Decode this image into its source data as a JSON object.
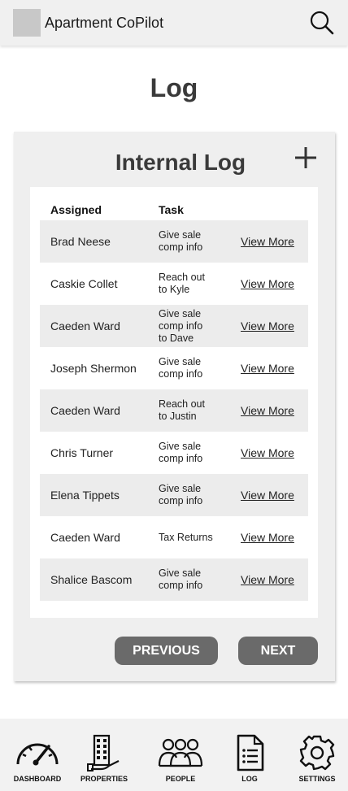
{
  "app": {
    "title": "Apartment CoPilot"
  },
  "header": {
    "search_icon": "search-icon",
    "logo_icon": "logo-placeholder"
  },
  "page": {
    "title": "Log"
  },
  "card": {
    "title": "Internal Log",
    "add_icon": "plus-icon"
  },
  "table": {
    "columns": [
      "Assigned",
      "Task"
    ],
    "link_label": "View More",
    "rows": [
      {
        "assigned": "Brad Neese",
        "task": "Give sale\ncomp info"
      },
      {
        "assigned": "Caskie Collet",
        "task": "Reach out\nto Kyle"
      },
      {
        "assigned": "Caeden Ward",
        "task": "Give sale\ncomp info\nto Dave"
      },
      {
        "assigned": "Joseph Shermon",
        "task": "Give sale\ncomp info"
      },
      {
        "assigned": "Caeden Ward",
        "task": "Reach out\nto Justin"
      },
      {
        "assigned": "Chris Turner",
        "task": "Give sale\ncomp info"
      },
      {
        "assigned": "Elena Tippets",
        "task": "Give sale\ncomp info"
      },
      {
        "assigned": "Caeden Ward",
        "task": "Tax Returns"
      },
      {
        "assigned": "Shalice Bascom",
        "task": "Give sale\ncomp info"
      }
    ]
  },
  "pagination": {
    "previous_label": "PREVIOUS",
    "next_label": "NEXT"
  },
  "nav": {
    "items": [
      {
        "label": "DASHBOARD",
        "icon": "gauge-icon"
      },
      {
        "label": "PROPERTIES",
        "icon": "building-icon"
      },
      {
        "label": "PEOPLE",
        "icon": "people-icon"
      },
      {
        "label": "LOG",
        "icon": "document-icon"
      },
      {
        "label": "SETTINGS",
        "icon": "gear-icon"
      }
    ]
  },
  "colors": {
    "button": "#6a6a6a",
    "row_shade": "#ececec",
    "card": "#efefef",
    "bar": "#f0f0f0"
  }
}
